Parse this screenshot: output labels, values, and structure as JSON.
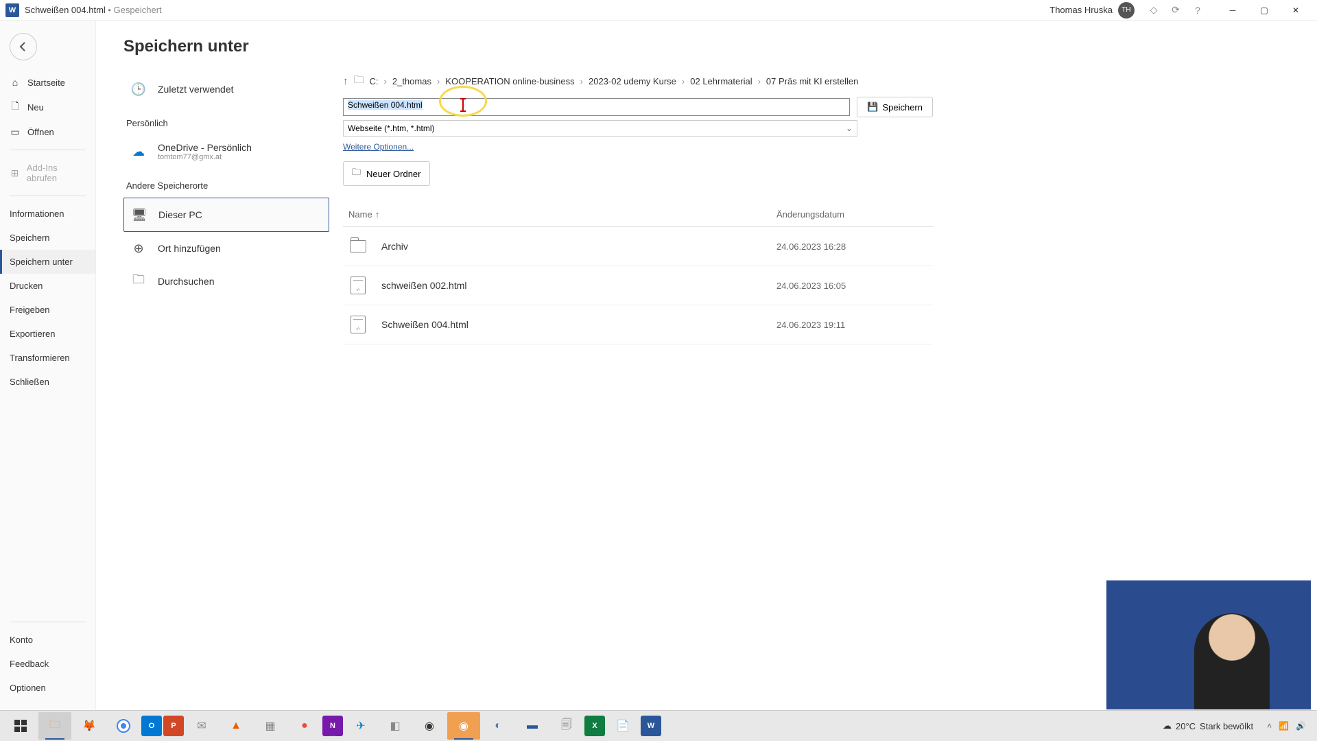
{
  "titlebar": {
    "doc_title": "Schweißen 004.html",
    "saved_status": "Gespeichert",
    "user_name": "Thomas Hruska",
    "user_initials": "TH"
  },
  "leftnav": {
    "items": [
      {
        "icon": "⌂",
        "label": "Startseite"
      },
      {
        "icon": "🗋",
        "label": "Neu"
      },
      {
        "icon": "▭",
        "label": "Öffnen"
      }
    ],
    "addins": "Add-Ins abrufen",
    "secondary": [
      "Informationen",
      "Speichern",
      "Speichern unter",
      "Drucken",
      "Freigeben",
      "Exportieren",
      "Transformieren",
      "Schließen"
    ],
    "bottom": [
      "Konto",
      "Feedback",
      "Optionen"
    ]
  },
  "page": {
    "title": "Speichern unter"
  },
  "locations": {
    "recent_label": "Zuletzt verwendet",
    "personal_heading": "Persönlich",
    "onedrive_label": "OneDrive - Persönlich",
    "onedrive_sub": "tomtom77@gmx.at",
    "other_heading": "Andere Speicherorte",
    "thispc_label": "Dieser PC",
    "addplace_label": "Ort hinzufügen",
    "browse_label": "Durchsuchen"
  },
  "breadcrumb": [
    "C:",
    "2_thomas",
    "KOOPERATION online-business",
    "2023-02 udemy Kurse",
    "02 Lehrmaterial",
    "07 Präs mit KI erstellen"
  ],
  "filename_value": "Schweißen 004.html",
  "filetype_value": "Webseite (*.htm, *.html)",
  "save_button": "Speichern",
  "more_options": "Weitere Optionen...",
  "new_folder": "Neuer Ordner",
  "columns": {
    "name": "Name",
    "date": "Änderungsdatum"
  },
  "files": [
    {
      "type": "folder",
      "name": "Archiv",
      "date": "24.06.2023 16:28"
    },
    {
      "type": "html",
      "name": "schweißen 002.html",
      "date": "24.06.2023 16:05"
    },
    {
      "type": "html",
      "name": "Schweißen 004.html",
      "date": "24.06.2023 19:11"
    }
  ],
  "taskbar": {
    "weather_temp": "20°C",
    "weather_text": "Stark bewölkt"
  }
}
